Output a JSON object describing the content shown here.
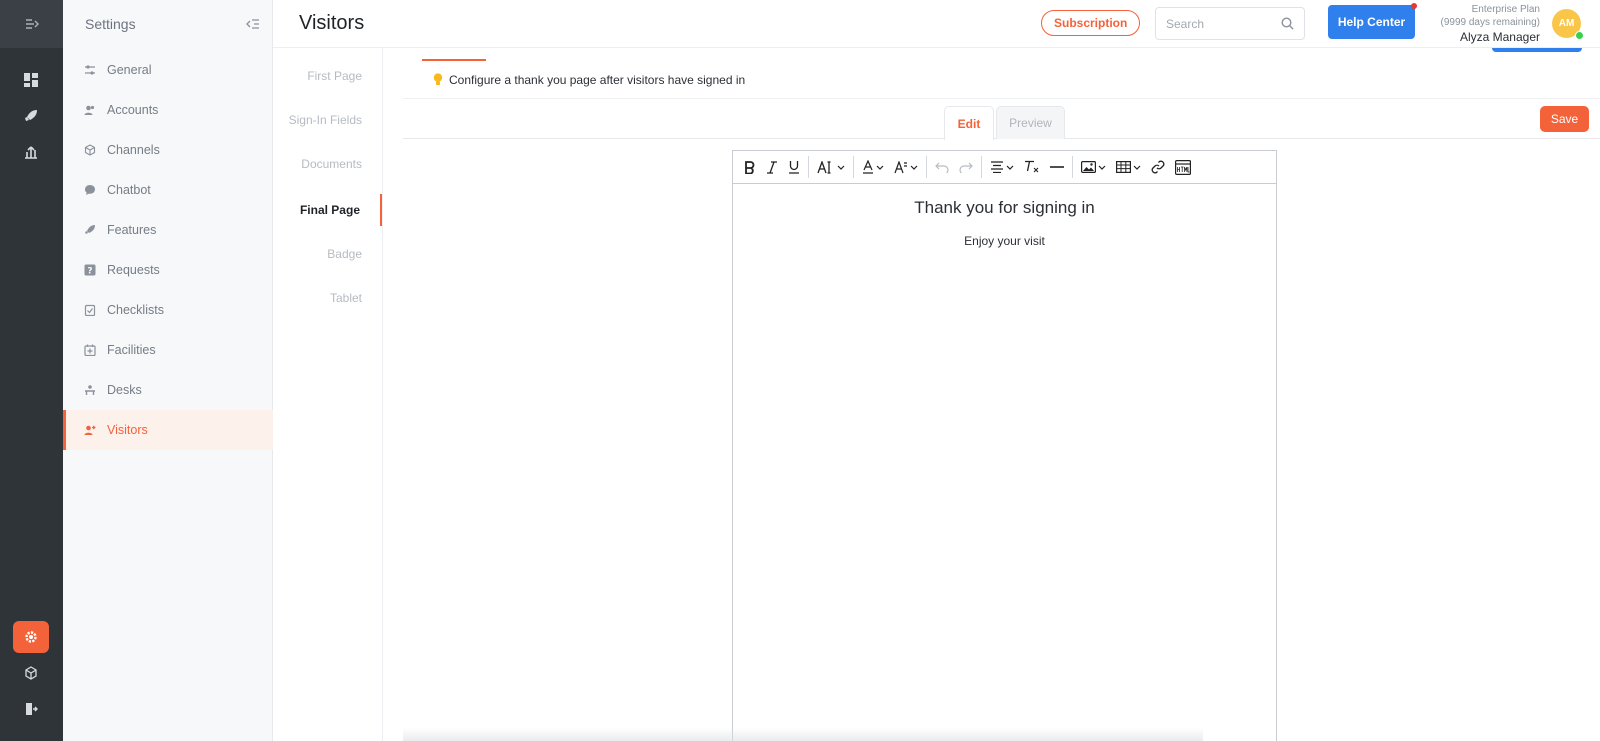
{
  "sidebar": {
    "title": "Settings",
    "items": [
      {
        "label": "General",
        "icon": "sliders-icon"
      },
      {
        "label": "Accounts",
        "icon": "users-icon"
      },
      {
        "label": "Channels",
        "icon": "cube-icon"
      },
      {
        "label": "Chatbot",
        "icon": "chat-icon"
      },
      {
        "label": "Features",
        "icon": "rocket-icon"
      },
      {
        "label": "Requests",
        "icon": "question-icon"
      },
      {
        "label": "Checklists",
        "icon": "checklist-icon"
      },
      {
        "label": "Facilities",
        "icon": "facility-icon"
      },
      {
        "label": "Desks",
        "icon": "desk-icon"
      },
      {
        "label": "Visitors",
        "icon": "visitor-icon"
      }
    ],
    "active": "Visitors"
  },
  "header": {
    "title": "Visitors",
    "subscription_label": "Subscription",
    "search_placeholder": "Search",
    "help_label": "Help Center",
    "plan_name": "Enterprise Plan",
    "plan_remaining": "(9999 days remaining)",
    "user_name": "Alyza Manager",
    "avatar_initials": "AM"
  },
  "subnav": {
    "items": [
      "First Page",
      "Sign-In Fields",
      "Documents",
      "Final Page",
      "Badge",
      "Tablet"
    ],
    "active": "Final Page"
  },
  "main": {
    "info_text": "Configure a thank you page after visitors have signed in",
    "tabs": {
      "edit": "Edit",
      "preview": "Preview"
    },
    "save_label": "Save"
  },
  "editor": {
    "heading": "Thank you for signing in",
    "paragraph": "Enjoy your visit"
  },
  "colors": {
    "accent": "#f4623a",
    "primary": "#2f80ed",
    "rail": "#2f3439"
  }
}
